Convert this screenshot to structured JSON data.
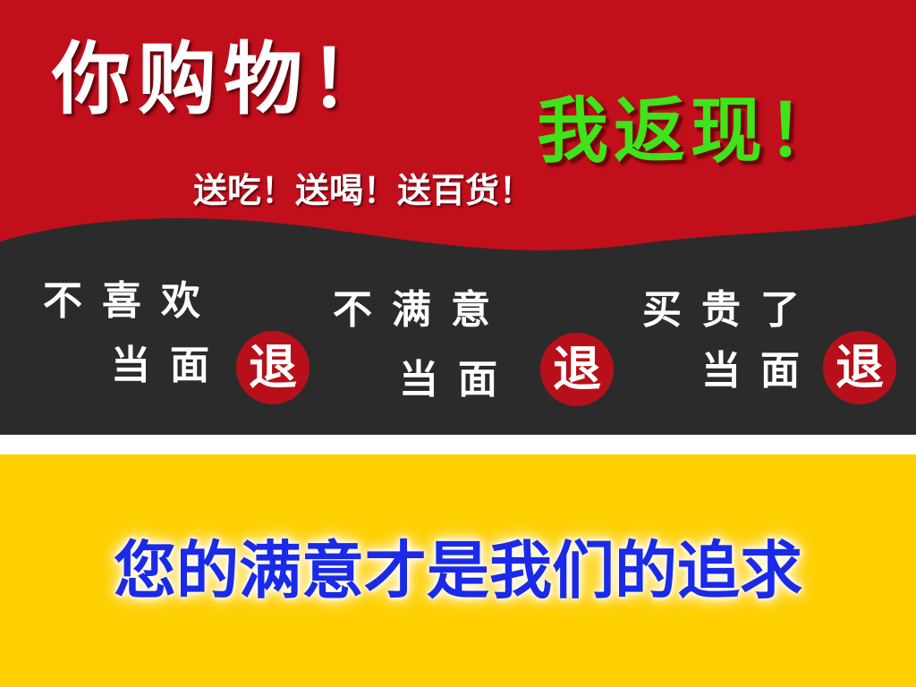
{
  "headline": "你购物！",
  "cashback": "我返现！",
  "gifts": "送吃！送喝！送百货！",
  "promises": [
    {
      "line1": "不喜欢",
      "line2": "当面",
      "badge": "退"
    },
    {
      "line1": "不满意",
      "line2": "当面",
      "badge": "退"
    },
    {
      "line1": "买贵了",
      "line2": "当面",
      "badge": "退"
    }
  ],
  "slogan": "您的满意才是我们的追求",
  "colors": {
    "red": "#c20f1c",
    "dark": "#2b2b2b",
    "yellow": "#ffd000",
    "green": "#3ee31a",
    "badge_red": "#b8101a",
    "slogan_blue": "#1a2ae8"
  }
}
